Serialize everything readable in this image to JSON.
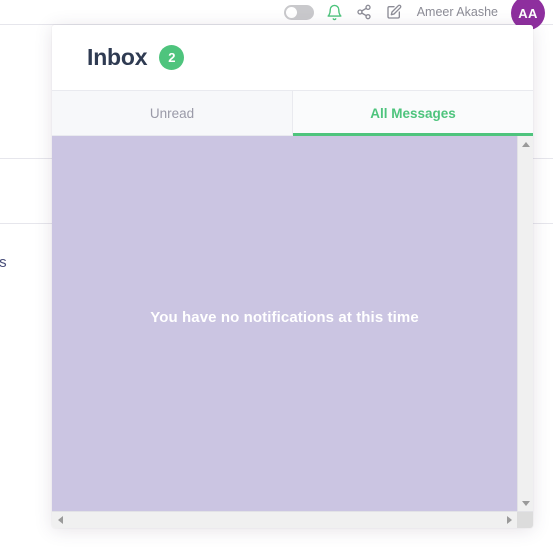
{
  "topbar": {
    "toggle": {
      "name": "notifications-toggle",
      "state": "off"
    },
    "icons": [
      {
        "name": "bell-icon",
        "label": "Notifications",
        "color": "#4ec47d"
      },
      {
        "name": "share-icon",
        "label": "Share",
        "color": "#8c8c96"
      },
      {
        "name": "compose-icon",
        "label": "Compose",
        "color": "#8c8c96"
      }
    ],
    "user_name": "Ameer Akashe",
    "avatar_initials": "AA",
    "avatar_color": "#8e2f9e"
  },
  "background": {
    "partial_text": "ress"
  },
  "modal": {
    "title": "Inbox",
    "badge_count": "2",
    "badge_color": "#4ec47d",
    "tabs": [
      {
        "label": "Unread",
        "active": false
      },
      {
        "label": "All Messages",
        "active": true
      }
    ],
    "content": {
      "empty_message": "You have no notifications at this time",
      "background_color": "#cbc5e2"
    },
    "scrollbars": {
      "vertical_up": "▲",
      "vertical_down": "▼",
      "horizontal_left": "◀",
      "horizontal_right": "▶"
    }
  }
}
